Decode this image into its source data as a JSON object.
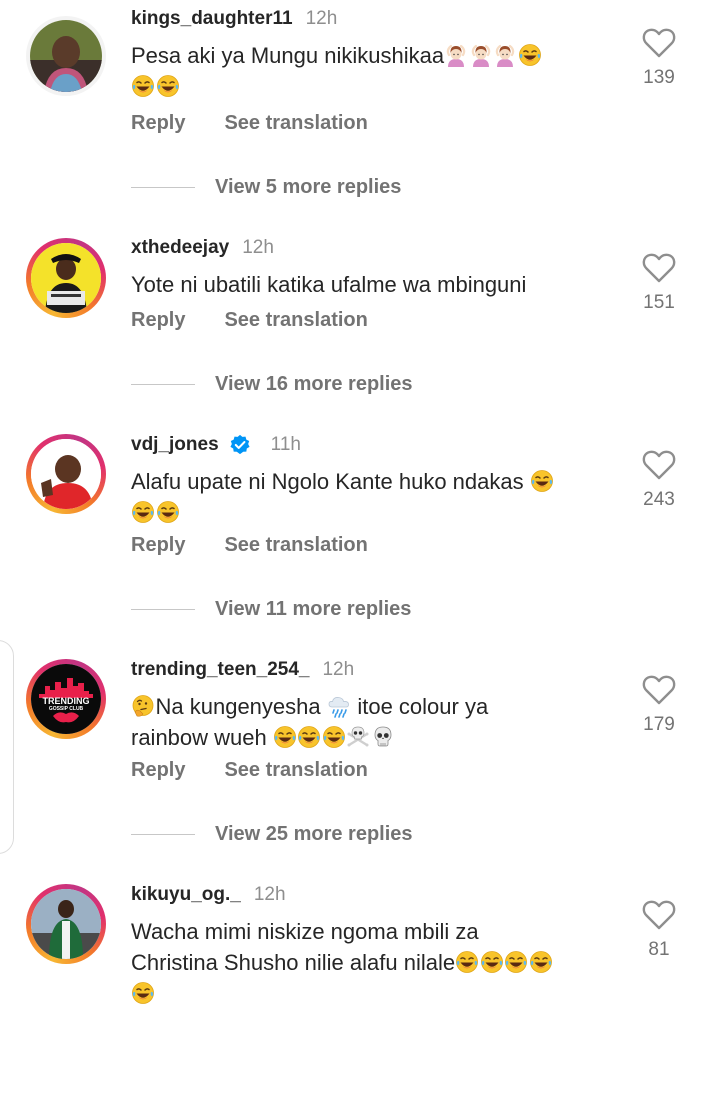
{
  "comments": [
    {
      "username": "kings_daughter11",
      "time": "12h",
      "verified": false,
      "text_segments": [
        {
          "t": "Pesa aki ya Mungu nikikushikaa"
        },
        {
          "e": "raising-hand"
        },
        {
          "e": "raising-hand"
        },
        {
          "e": "raising-hand"
        },
        {
          "e": "laughing-tears"
        },
        {
          "br": true
        },
        {
          "e": "laughing-tears"
        },
        {
          "e": "laughing-tears"
        }
      ],
      "likes": "139",
      "reply_label": "Reply",
      "translate_label": "See translation",
      "more_replies": "View 5 more replies"
    },
    {
      "username": "xthedeejay",
      "time": "12h",
      "verified": false,
      "text_segments": [
        {
          "t": "Yote ni ubatili katika ufalme wa mbinguni"
        }
      ],
      "likes": "151",
      "reply_label": "Reply",
      "translate_label": "See translation",
      "more_replies": "View 16 more replies"
    },
    {
      "username": "vdj_jones",
      "time": "11h",
      "verified": true,
      "text_segments": [
        {
          "t": "Alafu upate ni Ngolo Kante huko ndakas "
        },
        {
          "e": "laughing-tears"
        },
        {
          "br": true
        },
        {
          "e": "laughing-tears"
        },
        {
          "e": "laughing-tears"
        }
      ],
      "likes": "243",
      "reply_label": "Reply",
      "translate_label": "See translation",
      "more_replies": "View 11 more replies"
    },
    {
      "username": "trending_teen_254_",
      "time": "12h",
      "verified": false,
      "text_segments": [
        {
          "e": "thinking"
        },
        {
          "t": "Na kungenyesha "
        },
        {
          "e": "cloud-rain"
        },
        {
          "t": " itoe colour ya"
        },
        {
          "br": true
        },
        {
          "t": "rainbow wueh "
        },
        {
          "e": "laughing-tears"
        },
        {
          "e": "laughing-tears"
        },
        {
          "e": "laughing-tears"
        },
        {
          "e": "skull-crossbones"
        },
        {
          "e": "skull"
        }
      ],
      "avatar_text": [
        "TRENDING",
        "GOSSIP CLUB"
      ],
      "likes": "179",
      "reply_label": "Reply",
      "translate_label": "See translation",
      "more_replies": "View 25 more replies"
    },
    {
      "username": "kikuyu_og._",
      "time": "12h",
      "verified": false,
      "text_segments": [
        {
          "t": "Wacha mimi niskize ngoma mbili za"
        },
        {
          "br": true
        },
        {
          "t": "Christina Shusho nilie alafu nilale"
        },
        {
          "e": "laughing-tears"
        },
        {
          "e": "laughing-tears"
        },
        {
          "e": "laughing-tears"
        },
        {
          "e": "laughing-tears"
        },
        {
          "br": true
        },
        {
          "e": "laughing-tears"
        }
      ],
      "likes": "81"
    }
  ],
  "icons": {
    "like": "heart-outline-icon",
    "verified": "verified-badge-icon"
  },
  "colors": {
    "text": "#262626",
    "secondary": "#737373",
    "verified": "#0095f6",
    "story_ring": "#e1306c"
  }
}
